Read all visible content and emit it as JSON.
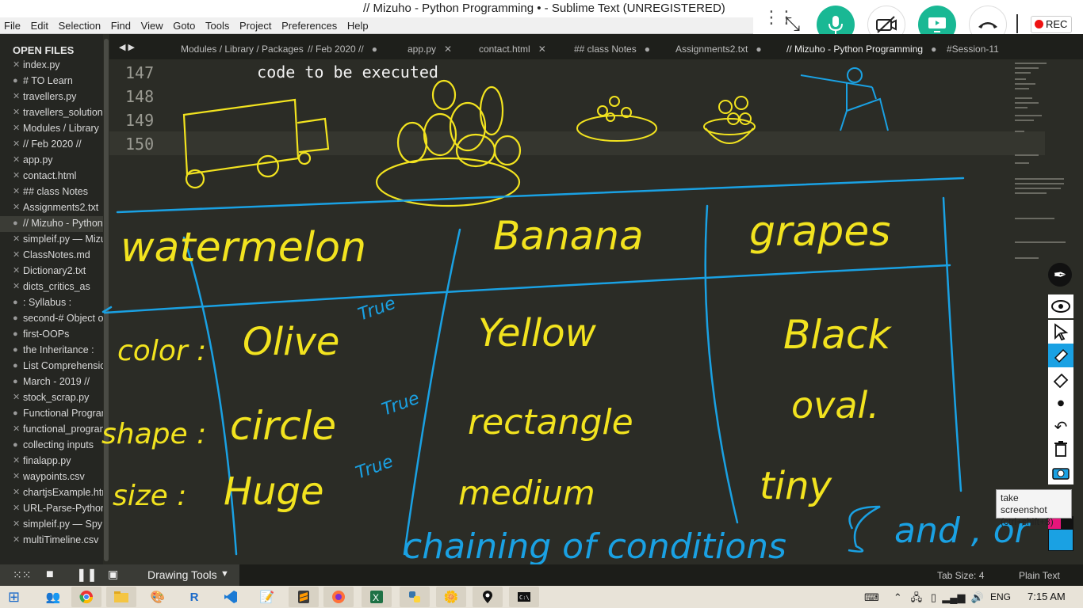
{
  "window": {
    "title": "// Mizuho - Python Programming • - Sublime Text (UNREGISTERED)"
  },
  "menu": [
    "File",
    "Edit",
    "Selection",
    "Find",
    "View",
    "Goto",
    "Tools",
    "Project",
    "Preferences",
    "Help"
  ],
  "meeting_bar": {
    "rec_label": "REC",
    "colors": {
      "mic": "#19b894",
      "camera": "#ffffff",
      "share": "#19b894",
      "leave": "#ffffff",
      "rec_dot": "#ee1111"
    }
  },
  "sidebar": {
    "header": "OPEN FILES",
    "files": [
      {
        "name": "index.py",
        "mark": "x"
      },
      {
        "name": "# TO Learn",
        "mark": "dot"
      },
      {
        "name": "travellers.py",
        "mark": "x"
      },
      {
        "name": "travellers_solution",
        "mark": "x"
      },
      {
        "name": "Modules / Library",
        "mark": "x"
      },
      {
        "name": "// Feb 2020 //",
        "mark": "x"
      },
      {
        "name": "app.py",
        "mark": "x"
      },
      {
        "name": "contact.html",
        "mark": "x"
      },
      {
        "name": "## class Notes",
        "mark": "x"
      },
      {
        "name": "Assignments2.txt",
        "mark": "x"
      },
      {
        "name": "// Mizuho - Python",
        "mark": "dot"
      },
      {
        "name": "simpleif.py — Mizu",
        "mark": "x"
      },
      {
        "name": "ClassNotes.md",
        "mark": "x"
      },
      {
        "name": "Dictionary2.txt",
        "mark": "x"
      },
      {
        "name": "dicts_critics_as",
        "mark": "x"
      },
      {
        "name": ": Syllabus :",
        "mark": "dot"
      },
      {
        "name": "second-# Object o",
        "mark": "dot"
      },
      {
        "name": "first-OOPs",
        "mark": "dot"
      },
      {
        "name": "the Inheritance :",
        "mark": "dot"
      },
      {
        "name": "List Comprehensio",
        "mark": "dot"
      },
      {
        "name": "March - 2019 //",
        "mark": "dot"
      },
      {
        "name": "stock_scrap.py",
        "mark": "x"
      },
      {
        "name": "Functional Program",
        "mark": "dot"
      },
      {
        "name": "functional_program",
        "mark": "x"
      },
      {
        "name": "collecting inputs",
        "mark": "dot"
      },
      {
        "name": "finalapp.py",
        "mark": "x"
      },
      {
        "name": "waypoints.csv",
        "mark": "x"
      },
      {
        "name": "chartjsExample.htm",
        "mark": "x"
      },
      {
        "name": "URL-Parse-Python",
        "mark": "x"
      },
      {
        "name": "simpleif.py — Spy",
        "mark": "x"
      },
      {
        "name": "multiTimeline.csv",
        "mark": "x"
      }
    ]
  },
  "tabs": [
    {
      "label": "Modules / Library / Packages",
      "close": ""
    },
    {
      "label": "// Feb 2020 //",
      "close": "●"
    },
    {
      "label": "app.py",
      "close": "✕"
    },
    {
      "label": "contact.html",
      "close": "✕"
    },
    {
      "label": "## class Notes",
      "close": "●"
    },
    {
      "label": "Assignments2.txt",
      "close": "●"
    },
    {
      "label": "// Mizuho - Python Programming",
      "close": "●"
    },
    {
      "label": "#Session-11",
      "close": ""
    }
  ],
  "editor": {
    "lines": [
      {
        "number": "147",
        "text": "    code to be executed"
      },
      {
        "number": "148",
        "text": ""
      },
      {
        "number": "149",
        "text": ""
      },
      {
        "number": "150",
        "text": ""
      }
    ]
  },
  "handwriting": {
    "fruits": [
      "watermelon",
      "Banana",
      "grapes"
    ],
    "rows": [
      {
        "label": "color :",
        "values": [
          "Olive",
          "Yellow",
          "Black"
        ]
      },
      {
        "label": "shape :",
        "values": [
          "circle",
          "rectangle",
          "oval."
        ]
      },
      {
        "label": "size :",
        "values": [
          "Huge",
          "medium",
          "tiny"
        ]
      }
    ],
    "true_marks": [
      "True",
      "True",
      "True"
    ],
    "caption": "chaining of conditions",
    "caption_extra": "and , or",
    "ink_colors": {
      "yellow": "#f2e31f",
      "blue": "#1aa1e3"
    }
  },
  "status_bar": {
    "tab_size": "Tab Size: 4",
    "syntax": "Plain Text"
  },
  "drawing_tools": {
    "label": "Drawing Tools"
  },
  "tooltip": {
    "line1": "take screenshot",
    "line2": "(ctrl+shift+8)"
  },
  "taskbar": {
    "language": "ENG",
    "time": "7:15 AM"
  }
}
